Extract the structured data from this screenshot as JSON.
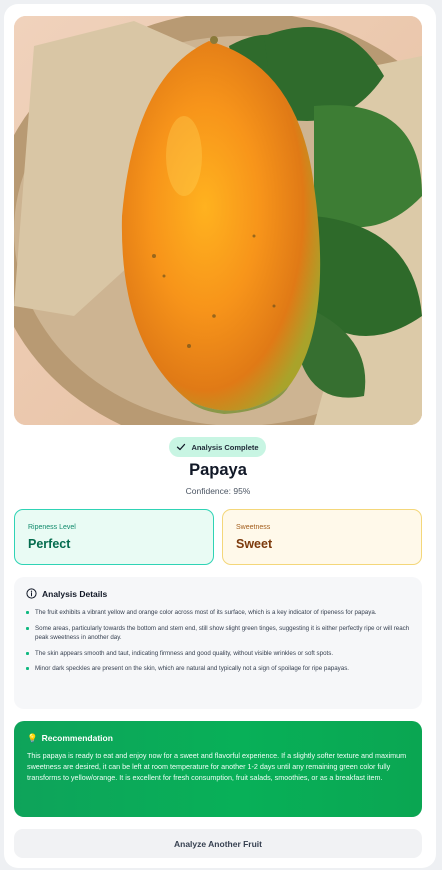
{
  "image": {
    "subject": "papaya",
    "alt_icon": "fruit-photo"
  },
  "status_badge": {
    "label": "Analysis Complete",
    "icon": "check-icon",
    "color": "#c8f5e3"
  },
  "result": {
    "fruit_name": "Papaya",
    "confidence": "Confidence: 95%"
  },
  "stats": {
    "ripeness": {
      "label": "Ripeness Level",
      "value": "Perfect",
      "accent": "#046c4e"
    },
    "sweetness": {
      "label": "Sweetness",
      "value": "Sweet",
      "accent": "#7c3a0c"
    }
  },
  "details": {
    "title": "Analysis Details",
    "icon": "info-icon",
    "items": [
      "The fruit exhibits a vibrant yellow and orange color across most of its surface, which is a key indicator of ripeness for papaya.",
      "Some areas, particularly towards the bottom and stem end, still show slight green tinges, suggesting it is either perfectly ripe or will reach peak sweetness in another day.",
      "The skin appears smooth and taut, indicating firmness and good quality, without visible wrinkles or soft spots.",
      "Minor dark speckles are present on the skin, which are natural and typically not a sign of spoilage for ripe papayas."
    ]
  },
  "recommendation": {
    "icon": "lightbulb-icon",
    "title": "Recommendation",
    "text": "This papaya is ready to eat and enjoy now for a sweet and flavorful experience. If a slightly softer texture and maximum sweetness are desired, it can be left at room temperature for another 1-2 days until any remaining green color fully transforms to yellow/orange. It is excellent for fresh consumption, fruit salads, smoothies, or as a breakfast item.",
    "color": "#08b058"
  },
  "actions": {
    "analyze_another": "Analyze Another Fruit"
  }
}
